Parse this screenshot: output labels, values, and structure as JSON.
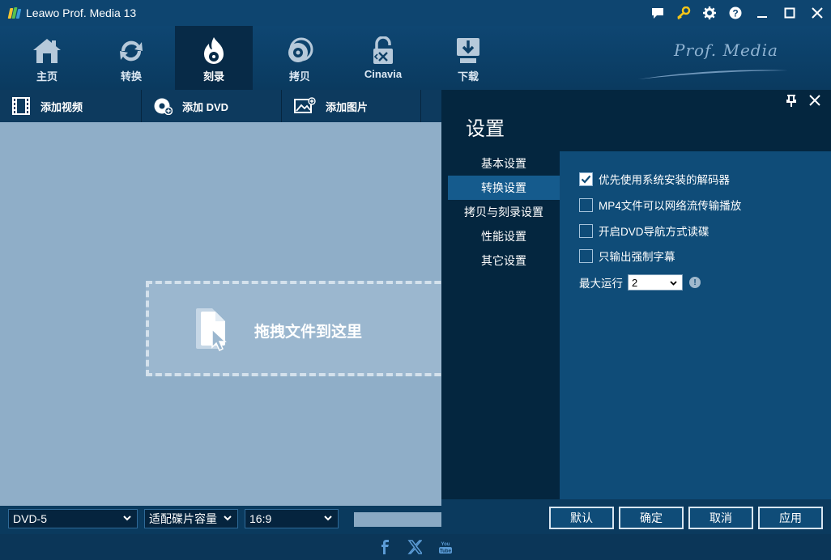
{
  "app": {
    "title": "Leawo Prof. Media 13"
  },
  "brand": {
    "text": "Prof. Media"
  },
  "nav": {
    "tabs": [
      {
        "label": "主页",
        "icon": "home-icon"
      },
      {
        "label": "转换",
        "icon": "convert-icon"
      },
      {
        "label": "刻录",
        "icon": "burn-icon",
        "active": true
      },
      {
        "label": "拷贝",
        "icon": "copy-disc-icon"
      },
      {
        "label": "Cinavia",
        "icon": "cinavia-icon"
      },
      {
        "label": "下载",
        "icon": "download-icon"
      }
    ]
  },
  "toolbar": {
    "add_video": "添加视频",
    "add_dvd": "添加 DVD",
    "add_image": "添加图片"
  },
  "dropzone": {
    "text": "拖拽文件到这里"
  },
  "bottombar": {
    "disc_type": "DVD-5",
    "fit_mode": "适配碟片容量",
    "aspect": "16:9"
  },
  "settings": {
    "title": "设置",
    "nav": [
      {
        "label": "基本设置"
      },
      {
        "label": "转换设置",
        "active": true
      },
      {
        "label": "拷贝与刻录设置"
      },
      {
        "label": "性能设置"
      },
      {
        "label": "其它设置"
      }
    ],
    "options": [
      {
        "label": "优先使用系统安装的解码器",
        "checked": true
      },
      {
        "label": "MP4文件可以网络流传输播放",
        "checked": false
      },
      {
        "label": "开启DVD导航方式读碟",
        "checked": false
      },
      {
        "label": "只输出强制字幕",
        "checked": false
      }
    ],
    "max_run_label": "最大运行",
    "max_run_value": "2",
    "buttons": {
      "default": "默认",
      "ok": "确定",
      "cancel": "取消",
      "apply": "应用"
    }
  },
  "colors": {
    "titlebar": "#0e4570",
    "active_tab": "#072a47",
    "content_bg": "#8faec8",
    "settings_bg": "#04263f",
    "settings_panel": "#0f4c78"
  }
}
